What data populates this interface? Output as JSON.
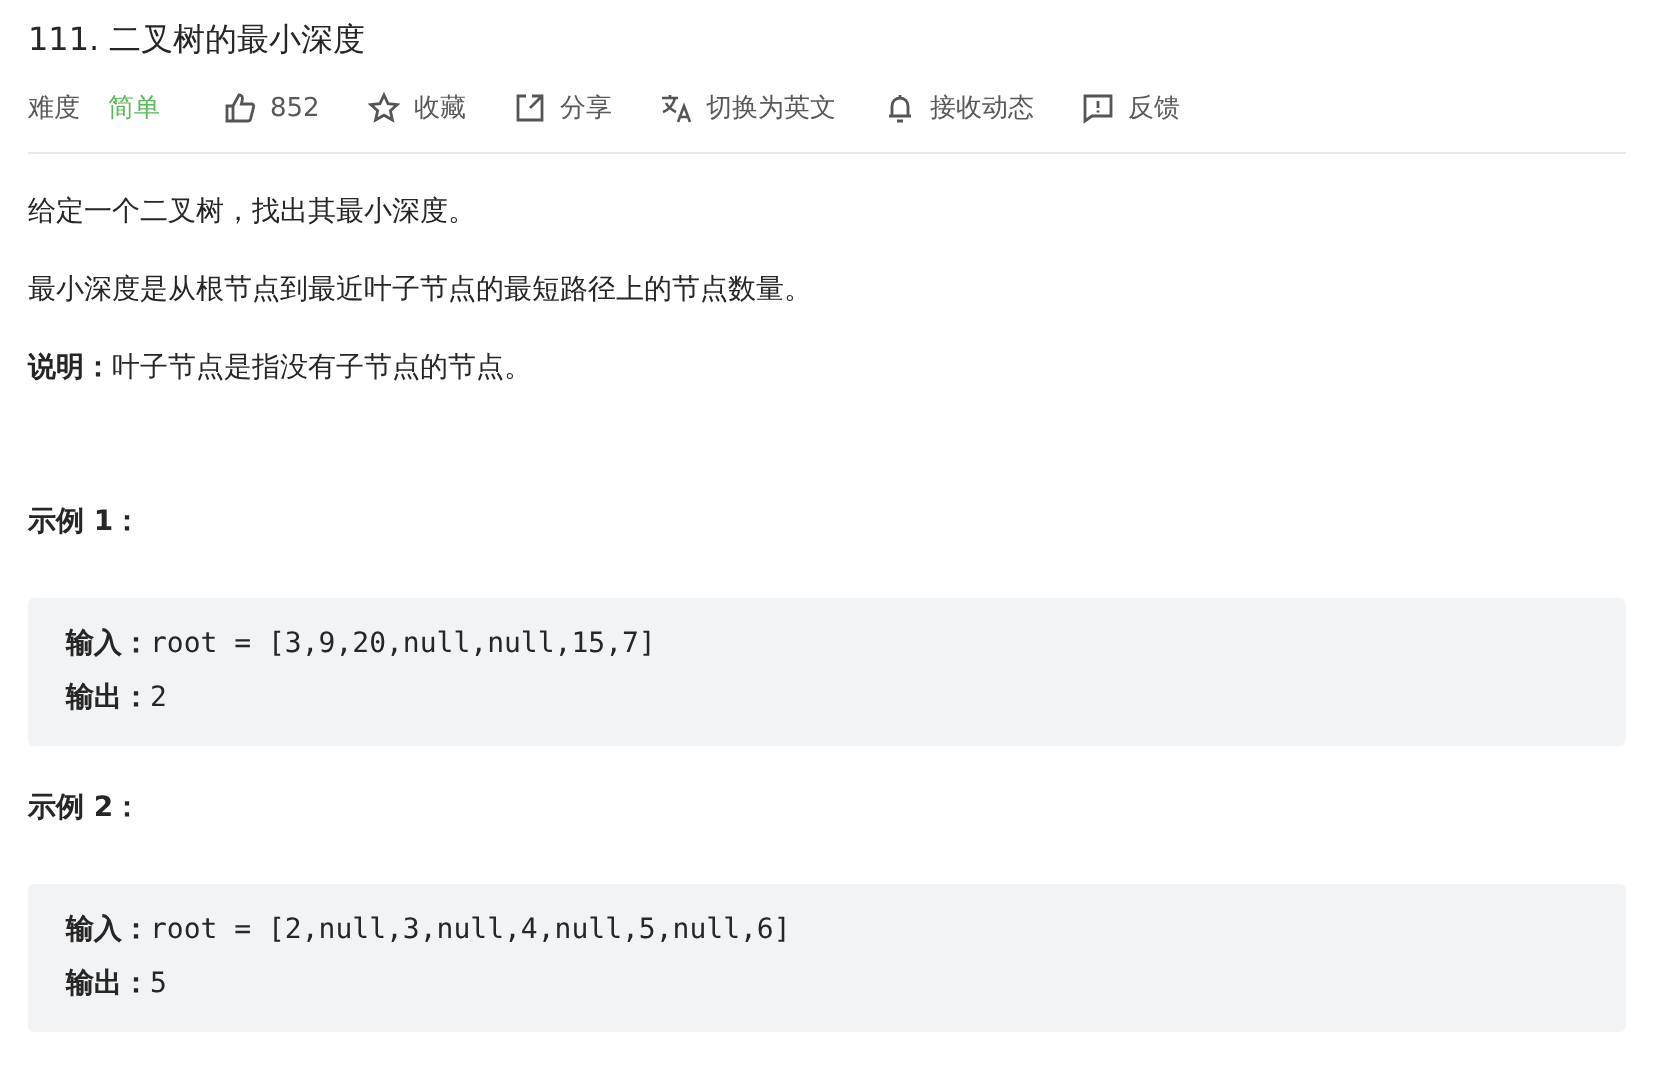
{
  "title": "111. 二叉树的最小深度",
  "toolbar": {
    "difficulty_label": "难度",
    "difficulty": "简单",
    "actions": [
      {
        "kind": "like",
        "label": "852"
      },
      {
        "kind": "star",
        "label": "收藏"
      },
      {
        "kind": "share",
        "label": "分享"
      },
      {
        "kind": "translate",
        "label": "切换为英文"
      },
      {
        "kind": "bell",
        "label": "接收动态"
      },
      {
        "kind": "feedback",
        "label": "反馈"
      }
    ]
  },
  "paragraphs": [
    "给定一个二叉树，找出其最小深度。",
    "最小深度是从根节点到最近叶子节点的最短路径上的节点数量。",
    "**说明：**叶子节点是指没有子节点的节点。"
  ],
  "examples": [
    {
      "heading": "示例 1：",
      "lines": [
        {
          "label": "输入：",
          "code": "root = [3,9,20,null,null,15,7]"
        },
        {
          "label": "输出：",
          "code": "2"
        }
      ]
    },
    {
      "heading": "示例 2：",
      "lines": [
        {
          "label": "输入：",
          "code": "root = [2,null,3,null,4,null,5,null,6]"
        },
        {
          "label": "输出：",
          "code": "5"
        }
      ]
    }
  ]
}
